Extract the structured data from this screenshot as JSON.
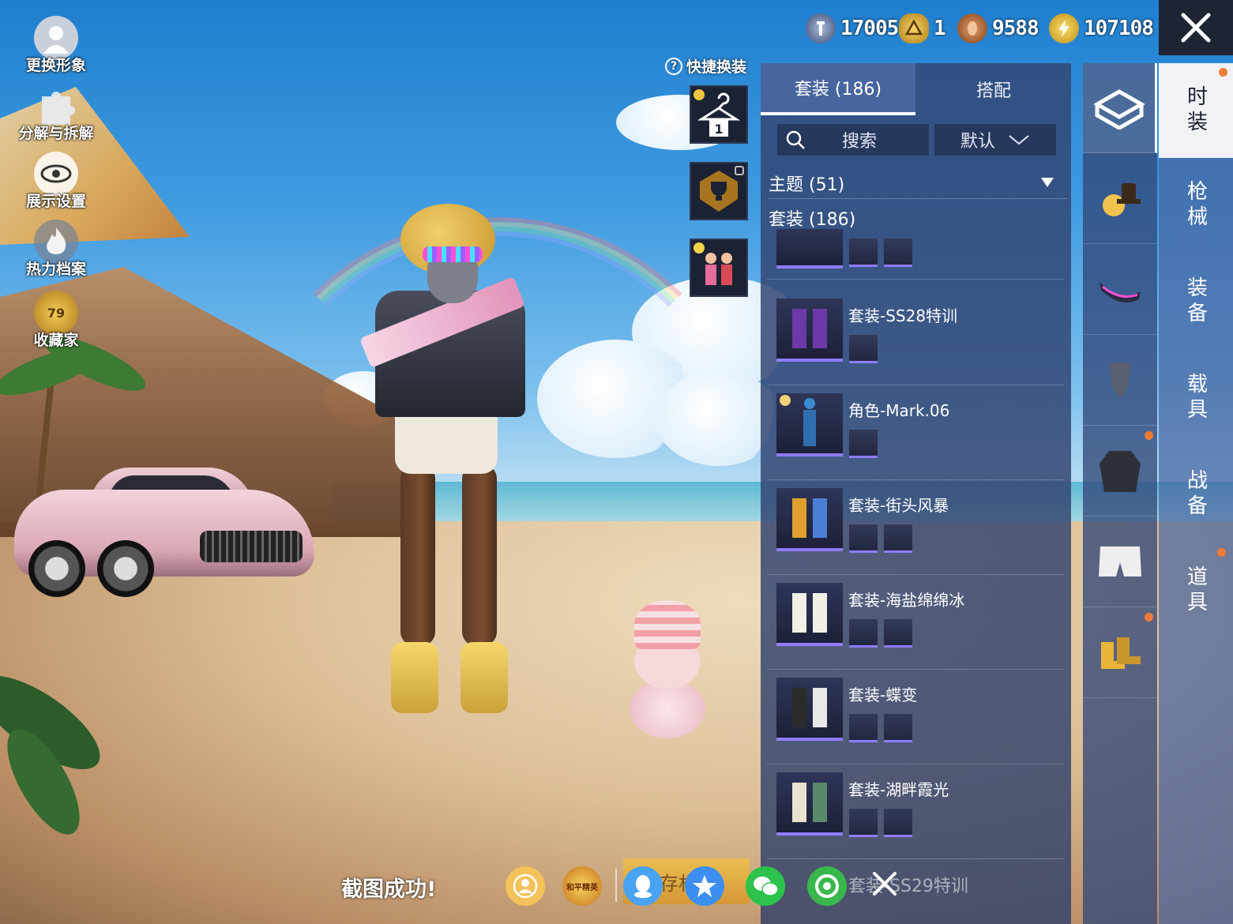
{
  "left_menu": [
    {
      "label": "更换形象",
      "icon": "avatar-icon"
    },
    {
      "label": "分解与拆解",
      "icon": "puzzle-icon"
    },
    {
      "label": "展示设置",
      "icon": "eye-icon"
    },
    {
      "label": "热力档案",
      "icon": "flame-icon"
    },
    {
      "label": "收藏家",
      "icon": "collector-badge-icon",
      "badge": "79"
    }
  ],
  "currency": [
    {
      "icon": "silver-coin-icon",
      "value": "17005",
      "color": "#8fa8d8"
    },
    {
      "icon": "gold-badge-icon",
      "value": "1",
      "color": "#e1b330"
    },
    {
      "icon": "bronze-coin-icon",
      "value": "9588",
      "color": "#c9824a"
    },
    {
      "icon": "energy-coin-icon",
      "value": "107108",
      "color": "#f2c63a"
    }
  ],
  "quick": {
    "label": "快捷换装",
    "slot_number": "1"
  },
  "panel": {
    "tabs": [
      "套装 (186)",
      "搭配"
    ],
    "search_placeholder": "搜索",
    "sort_value": "默认",
    "theme_label": "主题 (51)",
    "suit_count": "套装 (186)",
    "items": [
      {
        "name": "套装-SS28特训"
      },
      {
        "name": "角色-Mark.06"
      },
      {
        "name": "套装-街头风暴"
      },
      {
        "name": "套装-海盐绵绵冰"
      },
      {
        "name": "套装-蝶变"
      },
      {
        "name": "套装-湖畔霞光"
      }
    ],
    "peek_item": "套装-SS29特训"
  },
  "main_tabs": [
    "时装",
    "枪械",
    "装备",
    "载具",
    "战备",
    "道具"
  ],
  "category_icons": [
    "crate-icon",
    "hat-icon",
    "visor-icon",
    "mask-icon",
    "jacket-icon",
    "shorts-icon",
    "shoes-icon"
  ],
  "bottom": {
    "screenshot_success": "截图成功!",
    "save_label": "保存相册",
    "share_icons": [
      "team-icon",
      "game-for-peace-icon",
      "qq-icon",
      "qzone-icon",
      "wechat-icon",
      "moments-icon"
    ],
    "game_logo_text": "和平精英"
  },
  "colors": {
    "panel": "#344876",
    "accent_orange": "#ef7b37",
    "rarity_purple": "#8f7cff",
    "selected_tab_bg": "#f0f2f6"
  }
}
